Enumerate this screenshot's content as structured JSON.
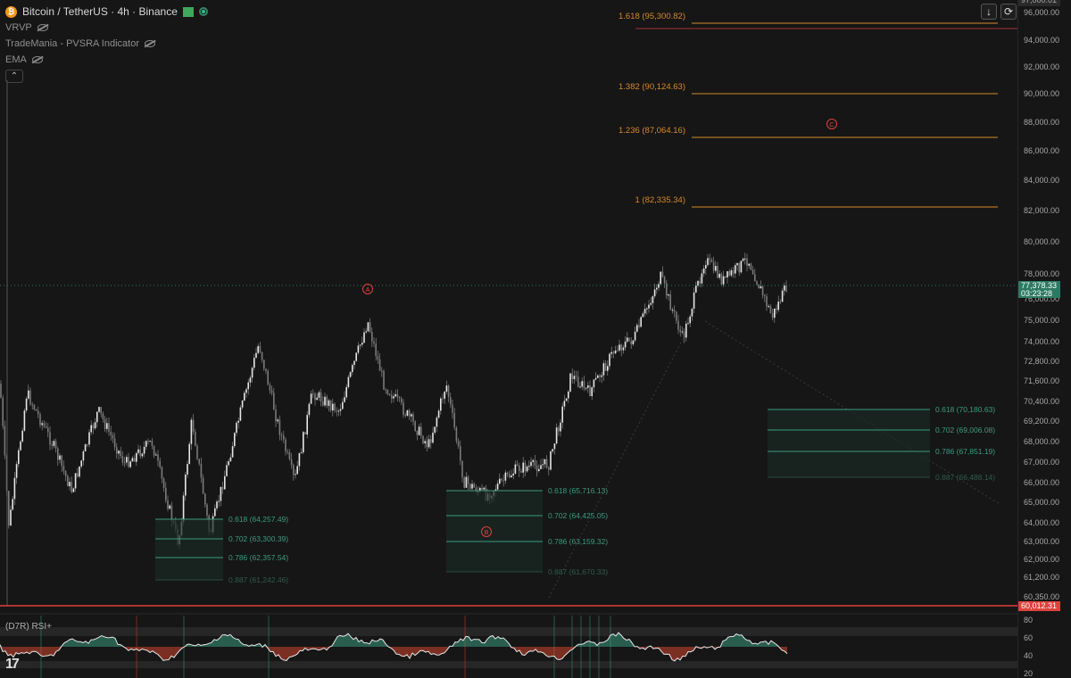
{
  "header": {
    "symbol_title": "Bitcoin / TetherUS · 4h · Binance",
    "coin_icon": "bitcoin-icon",
    "indicators": [
      {
        "label": "VRVP",
        "icon": "eye-hidden-icon"
      },
      {
        "label": "TradeMania - PVSRA Indicator",
        "icon": "eye-hidden-icon"
      },
      {
        "label": "EMA",
        "icon": "eye-hidden-icon"
      }
    ],
    "collapse_icon": "chevron-up-icon"
  },
  "toolbar": {
    "download_icon": "arrow-down-icon",
    "refresh_icon": "refresh-icon"
  },
  "price_axis": {
    "labels": [
      "96,000.00",
      "94,000.00",
      "92,000.00",
      "90,000.00",
      "88,000.00",
      "86,000.00",
      "84,000.00",
      "82,000.00",
      "80,000.00",
      "78,000.00",
      "76,000.00",
      "75,000.00",
      "74,000.00",
      "72,800.00",
      "71,600.00",
      "70,400.00",
      "69,200.00",
      "68,000.00",
      "67,000.00",
      "66,000.00",
      "65,000.00",
      "64,000.00",
      "63,000.00",
      "62,000.00",
      "61,200.00",
      "60,350.00"
    ],
    "top_partial": "97,000.01",
    "current_price": "77,378.33",
    "countdown": "03:23:28",
    "support_price": "60,012.31"
  },
  "colors": {
    "background": "#161616",
    "candle": "#bdbdbd",
    "fib_upper": "#d4892a",
    "fib_zone": "#3a9b7e",
    "wave_label": "#e0413b",
    "support_line": "#e0413b",
    "current_price_tag": "#2d7a63",
    "rsi_up": "#3a9b7e",
    "rsi_down": "#d0452e"
  },
  "fib_extensions": [
    {
      "label": "1.618 (95,300.82)"
    },
    {
      "label": "1.382 (90,124.63)"
    },
    {
      "label": "1.236 (87,064.16)"
    },
    {
      "label": "1 (82,335.34)"
    }
  ],
  "fib_zones": [
    {
      "levels": [
        "0.618 (64,257.49)",
        "0.702 (63,300.39)",
        "0.786 (62,357.54)",
        "0.887 (61,242.46)"
      ]
    },
    {
      "levels": [
        "0.618 (65,716.13)",
        "0.702 (64,425.05)",
        "0.786 (63,159.32)",
        "0.887 (61,670.33)"
      ]
    },
    {
      "levels": [
        "0.618 (70,180.63)",
        "0.702 (69,006.08)",
        "0.786 (67,851.19)",
        "0.887 (66,488.14)"
      ]
    }
  ],
  "wave_labels": [
    "A",
    "B",
    "C"
  ],
  "rsi": {
    "label": "(D7R) RSI+",
    "axis": [
      "80",
      "60",
      "40",
      "20"
    ]
  },
  "logo": "17"
}
